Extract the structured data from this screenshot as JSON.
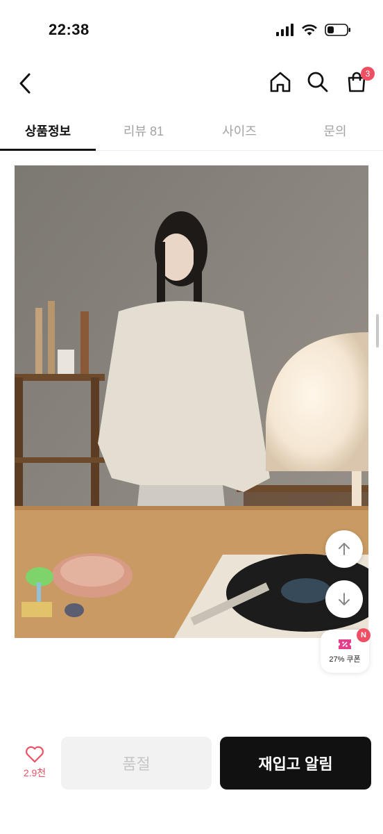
{
  "status_bar": {
    "time": "22:38"
  },
  "header": {
    "cart_count": "3"
  },
  "tabs": [
    {
      "label": "상품정보"
    },
    {
      "label": "리뷰 81"
    },
    {
      "label": "사이즈"
    },
    {
      "label": "문의"
    }
  ],
  "coupon": {
    "badge": "N",
    "label": "27% 쿠폰"
  },
  "bottom_bar": {
    "likes_count": "2.9천",
    "soldout_label": "품절",
    "restock_label": "재입고 알림"
  },
  "colors": {
    "accent": "#ef4f63",
    "primary_button": "#111111"
  }
}
